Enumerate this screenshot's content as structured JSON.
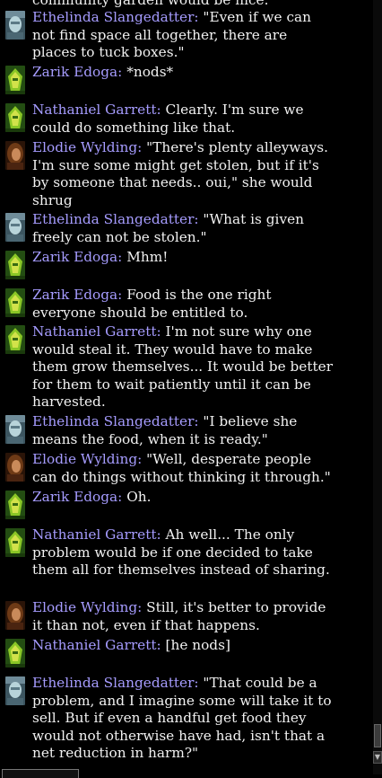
{
  "window": {
    "title": "",
    "cut_off_text": "community garden would be nice.\""
  },
  "avatars": {
    "Ethelinda Slangedatter": "pale-blue-face-portrait",
    "Zarik Edoga": "green-yellow-portrait",
    "Nathaniel Garrett": "green-yellow-portrait",
    "Elodie Wylding": "brown-haired-portrait"
  },
  "colors": {
    "speaker": "#a69cff",
    "message_text": "#f2f2f2",
    "background": "#000000"
  },
  "messages": [
    {
      "speaker": "Ethelinda Slangedatter:",
      "text": " \"Even if we can not find space all together, there are places to tuck boxes.\""
    },
    {
      "speaker": "Zarik Edoga:",
      "text": " *nods*"
    },
    {
      "speaker": "Nathaniel Garrett:",
      "text": " Clearly. I'm sure we could do something like that."
    },
    {
      "speaker": "Elodie Wylding:",
      "text": " \"There's plenty alleyways. I'm sure some might get stolen, but if it's by someone that needs.. oui,\" she would shrug"
    },
    {
      "speaker": "Ethelinda Slangedatter:",
      "text": " \"What is given freely can not be stolen.\""
    },
    {
      "speaker": "Zarik Edoga:",
      "text": " Mhm!"
    },
    {
      "speaker": "Zarik Edoga:",
      "text": " Food is the one right everyone should be entitled to."
    },
    {
      "speaker": "Nathaniel Garrett:",
      "text": " I'm not sure why one would steal it. They would have to make them grow themselves... It would be better for them to wait patiently until it can be harvested."
    },
    {
      "speaker": "Ethelinda Slangedatter:",
      "text": " \"I believe she means the food, when it is ready.\""
    },
    {
      "speaker": "Elodie Wylding:",
      "text": " \"Well, desperate people can do things without thinking it through.\""
    },
    {
      "speaker": "Zarik Edoga:",
      "text": " Oh."
    },
    {
      "speaker": "Nathaniel Garrett:",
      "text": " Ah well... The only problem would be if one decided to take them all for themselves instead of sharing."
    },
    {
      "speaker": "Elodie Wylding:",
      "text": " Still, it's better to provide it than not, even if that happens."
    },
    {
      "speaker": "Nathaniel Garrett:",
      "text": " [he nods]"
    },
    {
      "speaker": "Ethelinda Slangedatter:",
      "text": " \"That could be a problem, and I imagine some will take it to sell. But if even a handful get food they would not otherwise have had, isn't that a net reduction in harm?\""
    }
  ]
}
